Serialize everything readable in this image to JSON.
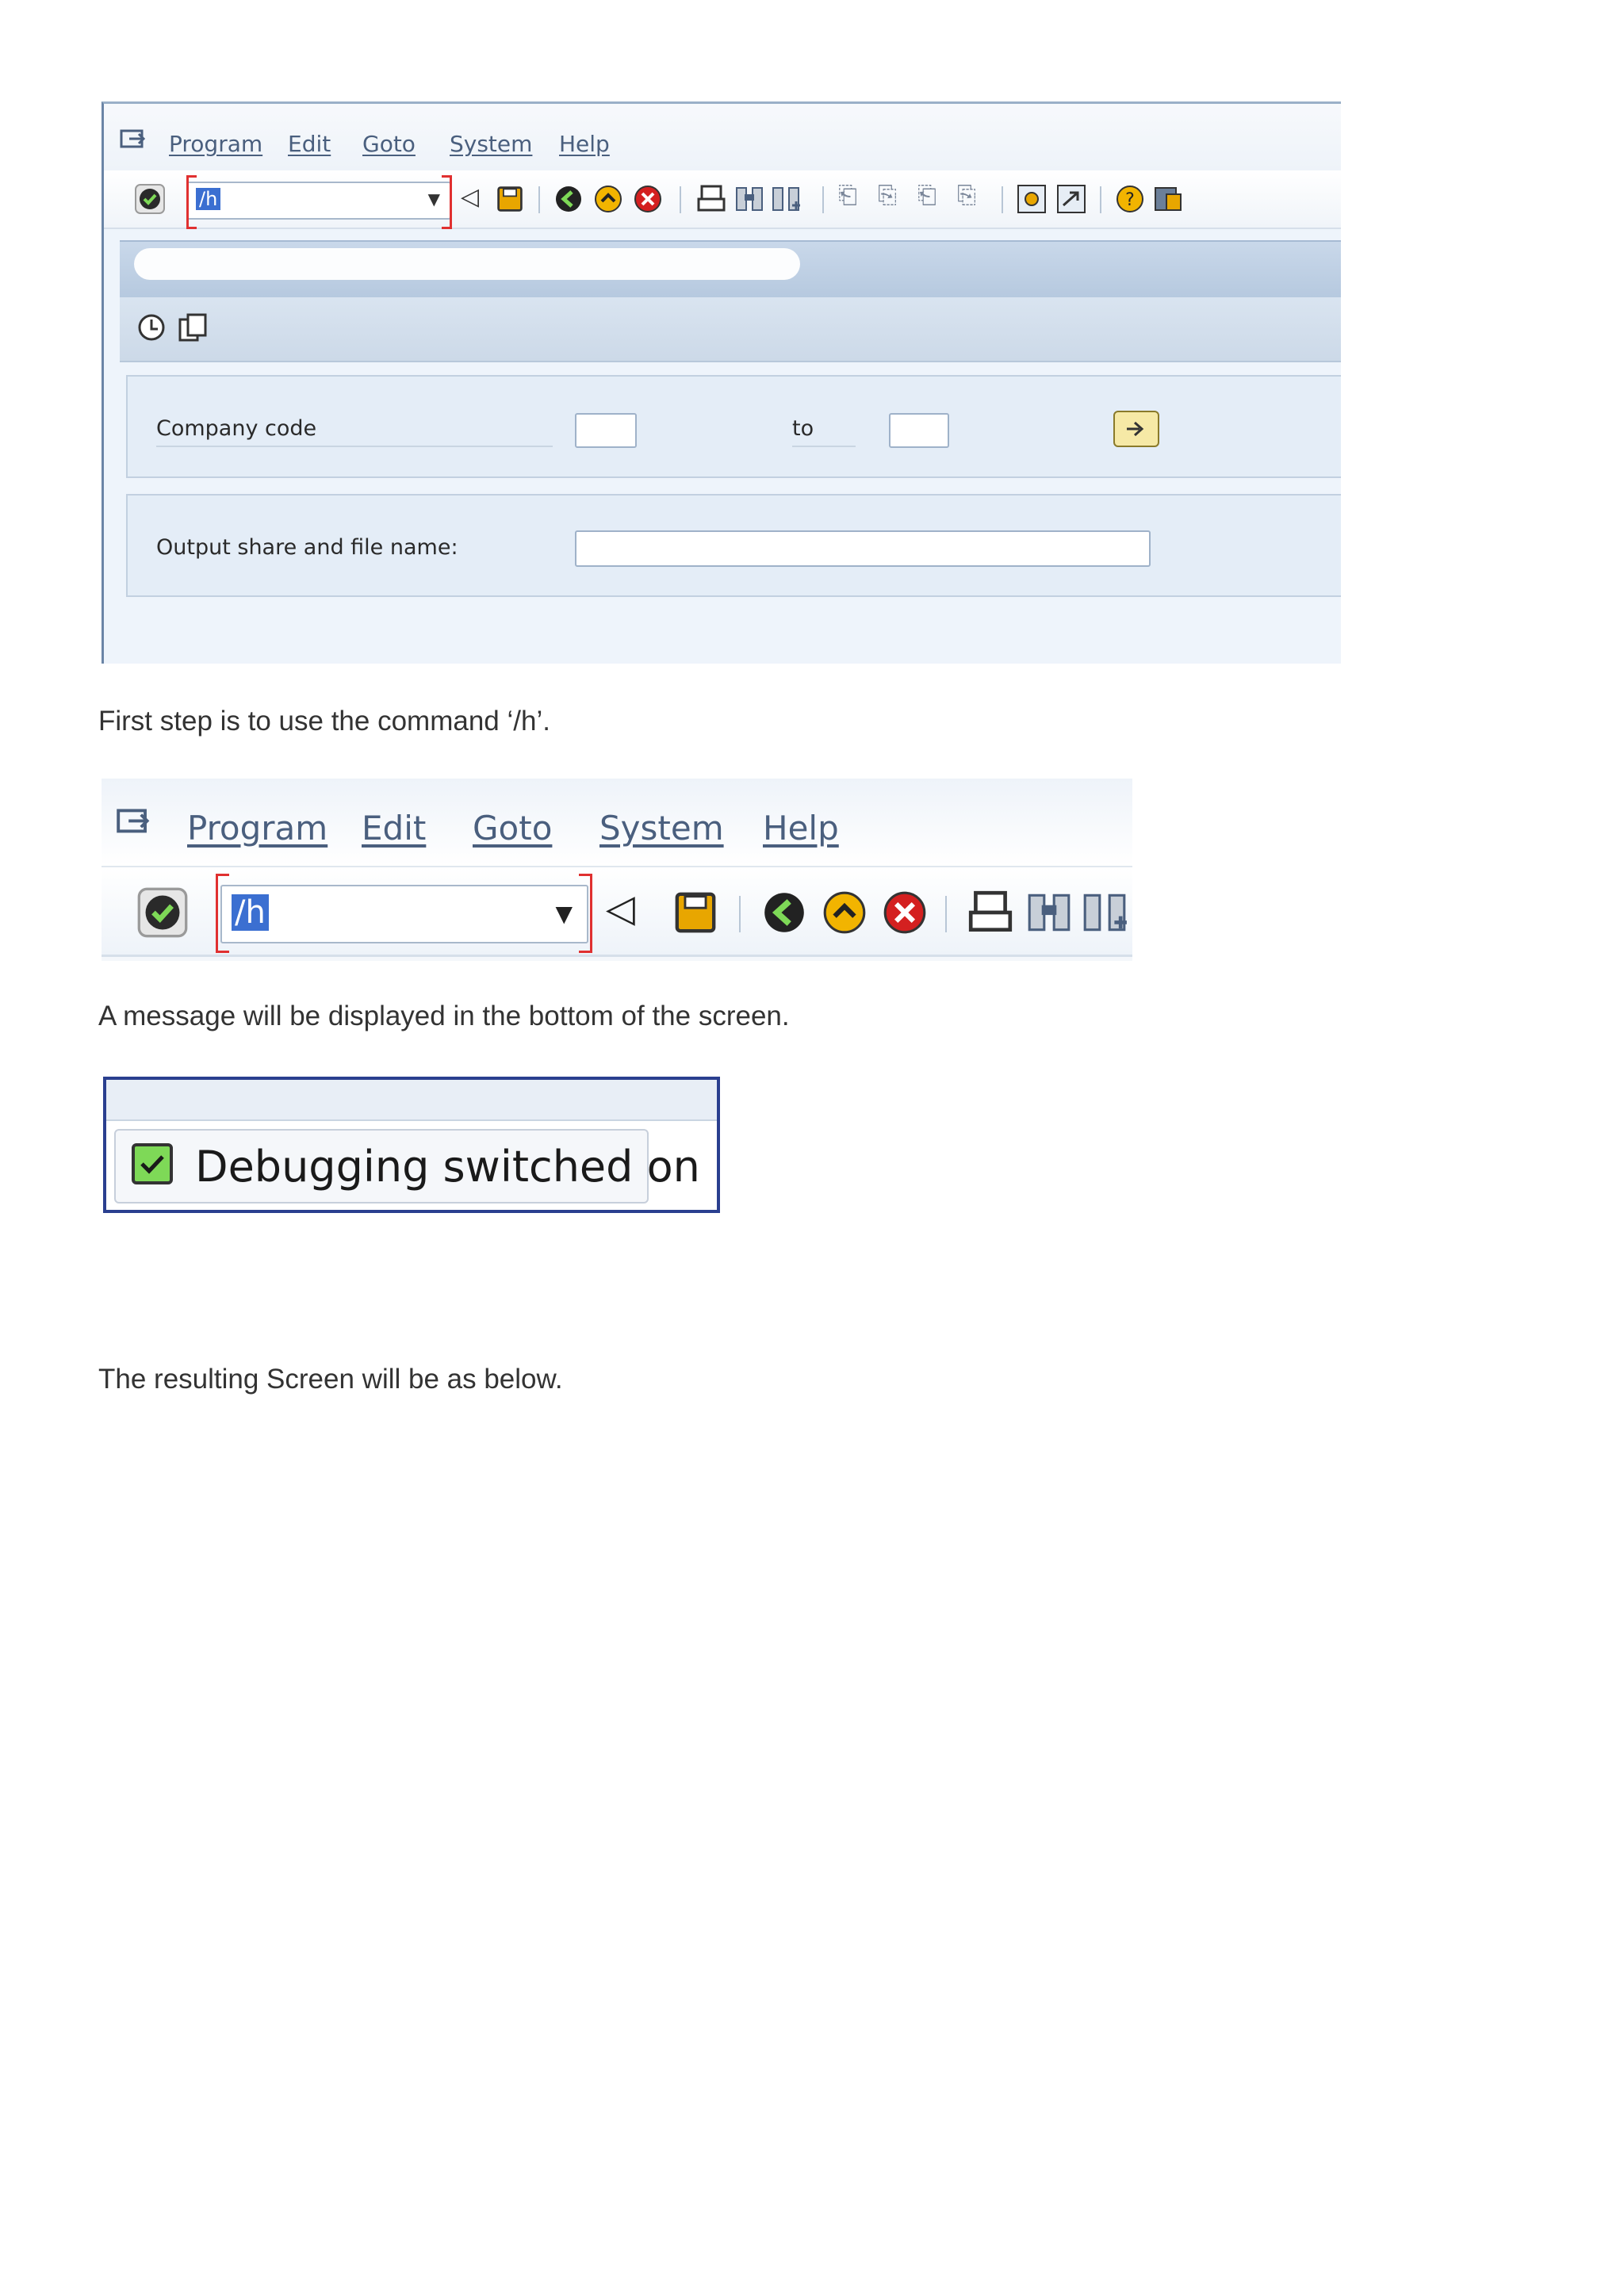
{
  "screenshot1": {
    "menu": [
      "Program",
      "Edit",
      "Goto",
      "System",
      "Help"
    ],
    "command_value": "/h",
    "company_code_label": "Company code",
    "to_label": "to",
    "output_label": "Output share and file name:"
  },
  "paragraph1": "First step is to use the command ‘/h’.",
  "screenshot2": {
    "menu": [
      "Program",
      "Edit",
      "Goto",
      "System",
      "Help"
    ],
    "command_value": "/h"
  },
  "paragraph2": "A message will be displayed in the bottom of the screen.",
  "screenshot3": {
    "status_message": "Debugging switched on"
  },
  "paragraph3": "The resulting Screen will be as below.",
  "icons": [
    "menu-icon",
    "enter-icon",
    "dropdown-icon",
    "back-triangle-icon",
    "save-icon",
    "back-icon",
    "exit-icon",
    "cancel-icon",
    "print-icon",
    "find-icon",
    "find-next-icon",
    "first-page-icon",
    "previous-page-icon",
    "next-page-icon",
    "last-page-icon",
    "new-session-icon",
    "shortcut-icon",
    "help-icon",
    "customize-icon",
    "execute-icon",
    "variant-icon",
    "multiple-selection-icon",
    "checkbox-icon"
  ]
}
